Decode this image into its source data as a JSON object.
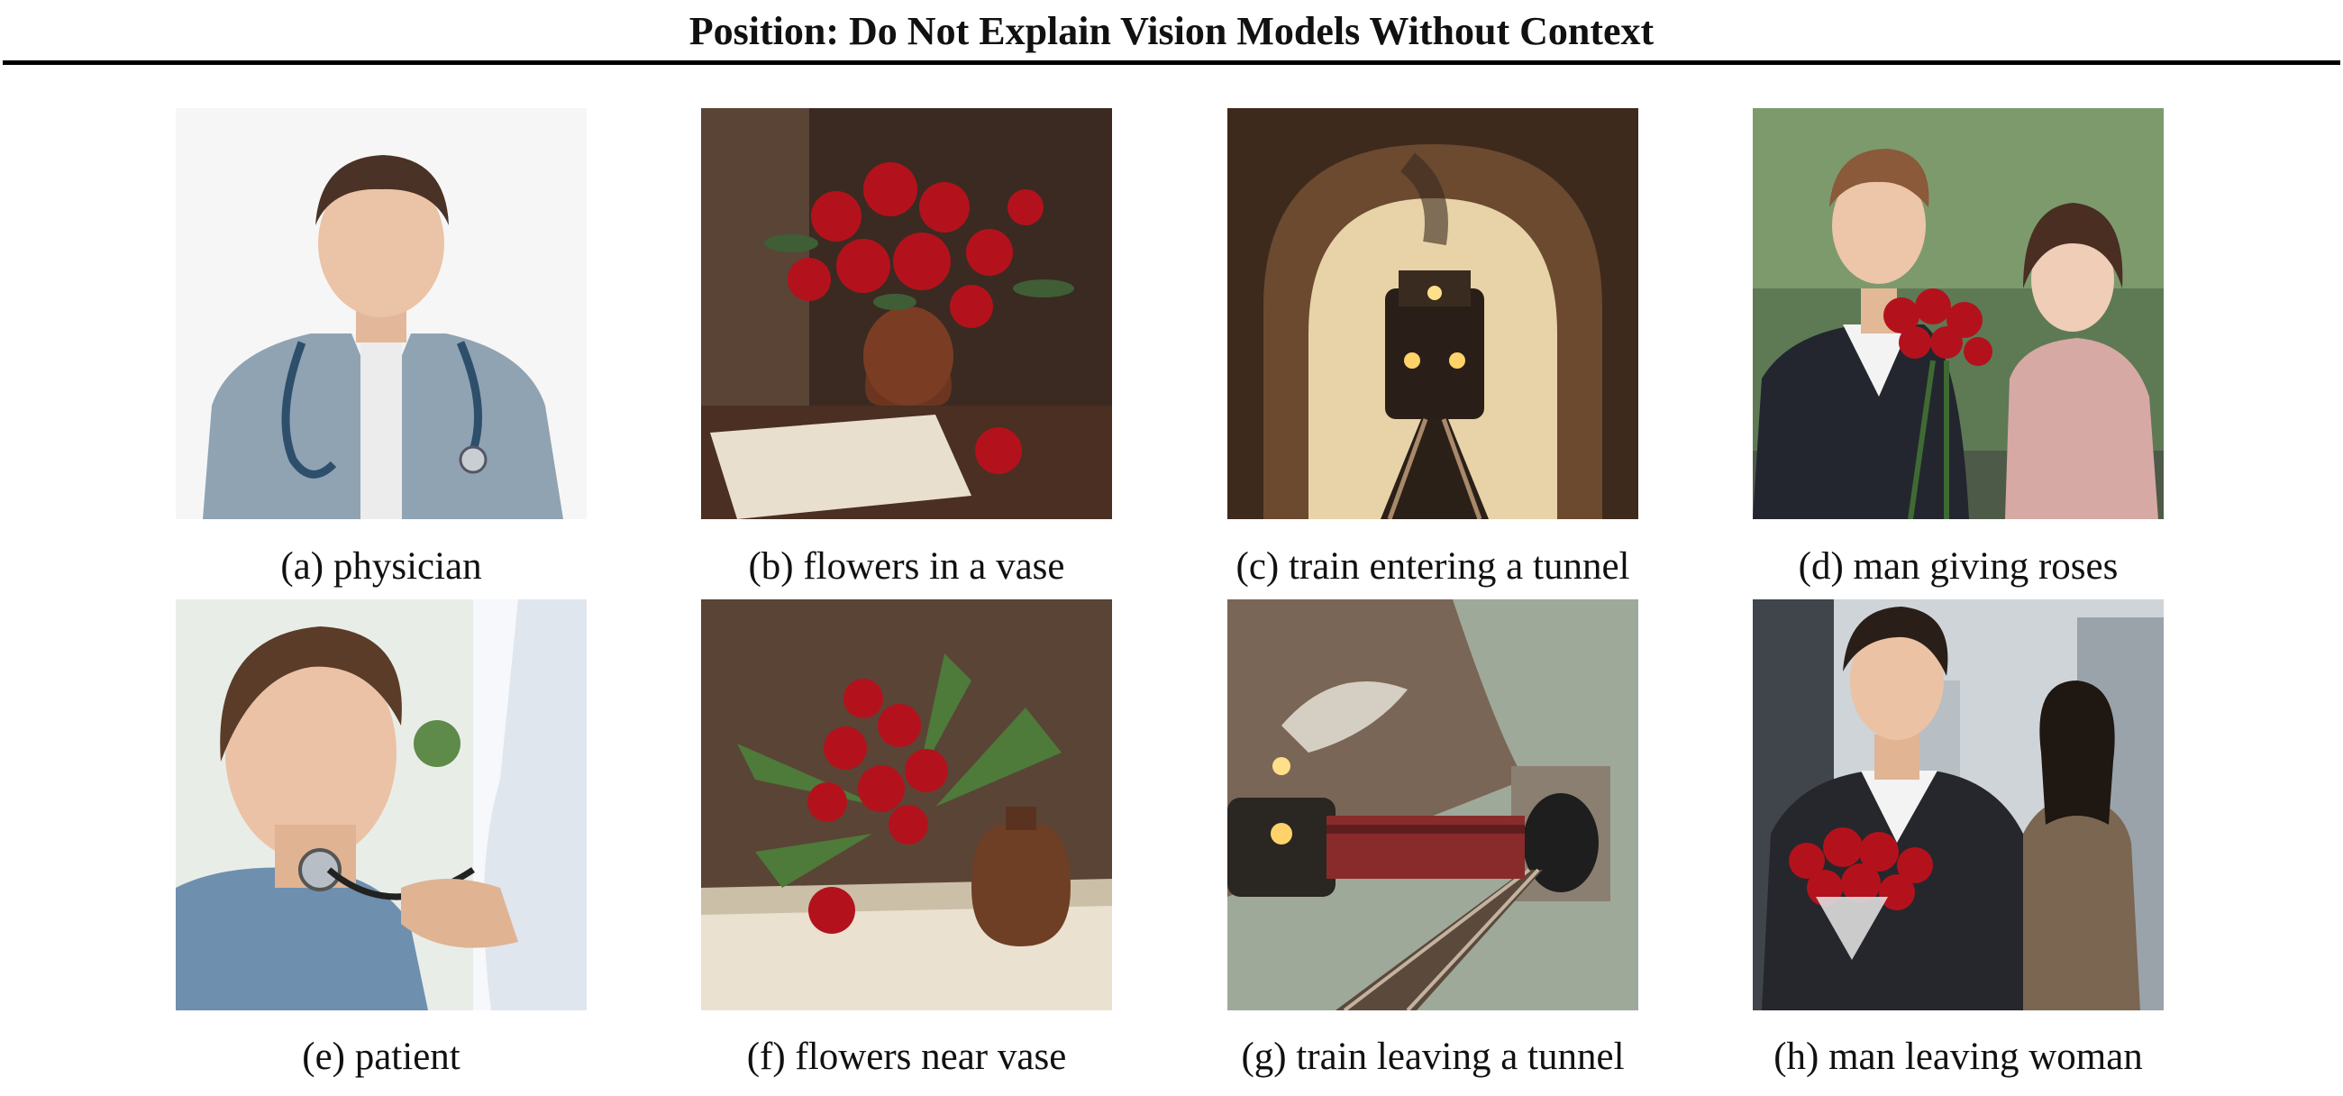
{
  "header": {
    "title": "Position: Do Not Explain Vision Models Without Context"
  },
  "figure": {
    "panels": [
      {
        "caption": "(a) physician"
      },
      {
        "caption": "(b) flowers in a vase"
      },
      {
        "caption": "(c) train entering a tunnel"
      },
      {
        "caption": "(d) man giving roses"
      },
      {
        "caption": "(e) patient"
      },
      {
        "caption": "(f) flowers near vase"
      },
      {
        "caption": "(g) train leaving a tunnel"
      },
      {
        "caption": "(h) man leaving woman"
      }
    ]
  },
  "colors": {
    "rose_red": "#b3121c",
    "text": "#111111",
    "rule": "#000000"
  }
}
